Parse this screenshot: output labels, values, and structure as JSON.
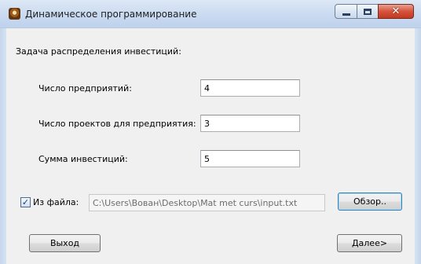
{
  "window": {
    "title": "Динамическое программирование",
    "icon": "app-icon",
    "controls": {
      "minimize": "minimize-icon",
      "maximize": "maximize-icon",
      "close": "close-icon"
    }
  },
  "form": {
    "heading": "Задача распределения инвестиций:",
    "enterprises_label": "Число предприятий:",
    "enterprises_value": "4",
    "projects_label": "Число проектов для предприятия:",
    "projects_value": "3",
    "investment_label": "Сумма инвестиций:",
    "investment_value": "5",
    "from_file": {
      "checked": true,
      "check_glyph": "✓",
      "label": "Из файла:",
      "path": "C:\\Users\\Вован\\Desktop\\Mat met curs\\input.txt",
      "browse_label": "Обзор.."
    }
  },
  "buttons": {
    "exit_label": "Выход",
    "next_label": "Далее>"
  },
  "colors": {
    "titlebar": "#c9daf0",
    "client": "#f0f0f0",
    "close_button": "#d6533b"
  }
}
